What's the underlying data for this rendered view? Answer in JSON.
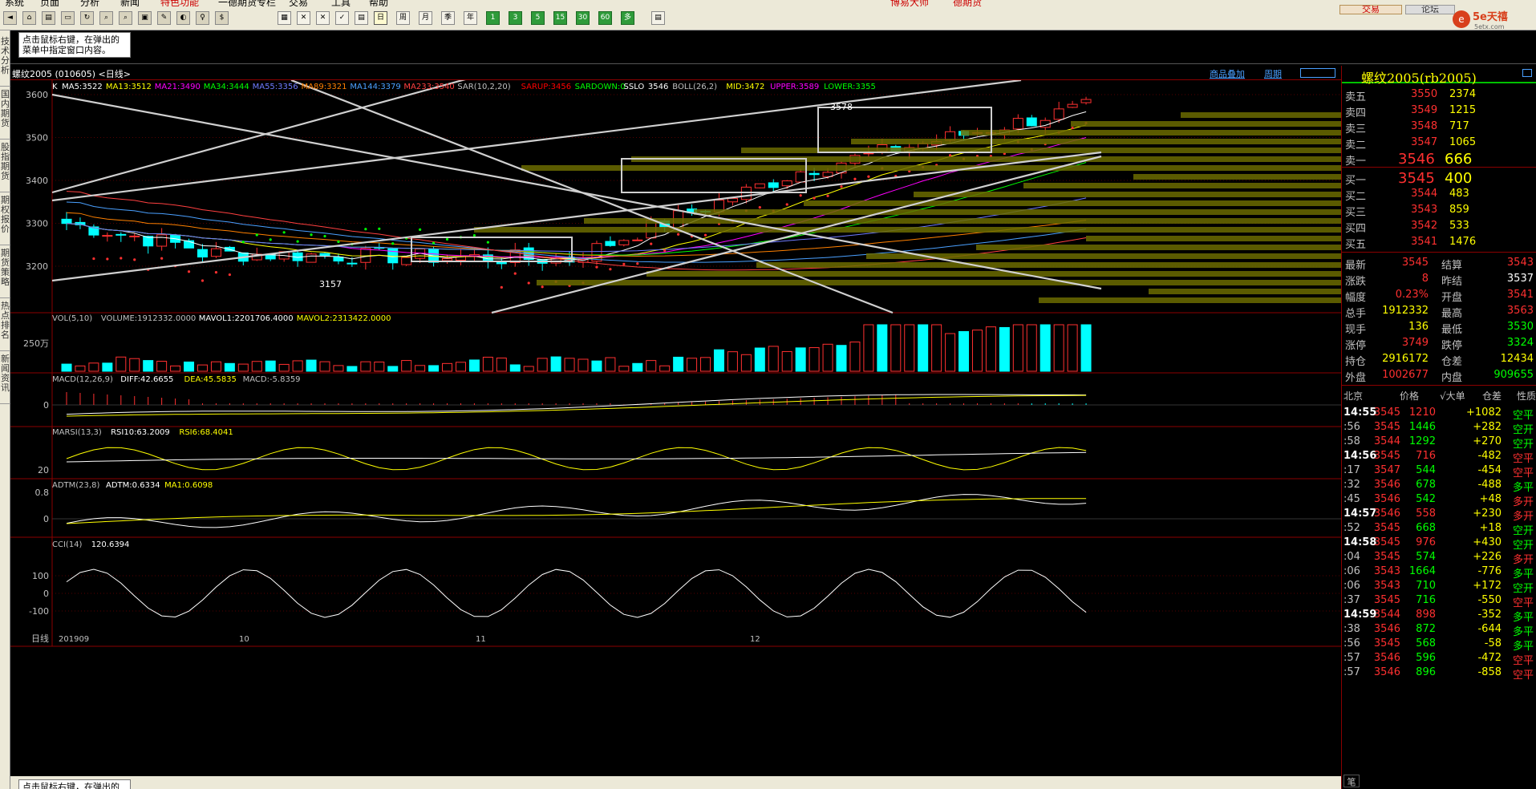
{
  "menu": [
    "系统",
    "页面",
    "分析",
    "新闻",
    "特色功能",
    "一德期货专栏",
    "交易",
    "工具",
    "帮助"
  ],
  "menu_right": [
    "博易大师",
    "德期货"
  ],
  "toolbar": {
    "buttons_a": [
      "◄",
      "⌂",
      "▤",
      "▭",
      "↻",
      "⌕",
      "⌕",
      "▣",
      "✎",
      "◐",
      "♀",
      "$"
    ],
    "periods": [
      "日",
      "周",
      "月",
      "季",
      "年"
    ],
    "minutes": [
      "1",
      "3",
      "5",
      "15",
      "30",
      "60",
      "多"
    ],
    "trade_label": "交易",
    "forum_label": "论坛"
  },
  "logo": {
    "text": "5e天禧",
    "sub": "5etx.com"
  },
  "sidebar_tabs": [
    "技术分析",
    "国内期货",
    "股指期货",
    "期权报价",
    "期货策略",
    "热点排名",
    "新闻资讯"
  ],
  "tip": {
    "text": "点击鼠标右键，在弹出的菜单中指定窗口内容。"
  },
  "tip_bottom": {
    "text": "点击鼠标右键，在弹出的"
  },
  "chart_title": "螺纹2005 (010605) <日线>",
  "chart_links": [
    "商品叠加",
    "周期"
  ],
  "main_indicators": [
    {
      "text": "K",
      "color": "#ffffff"
    },
    {
      "text": "MA5:3522",
      "color": "#ffffff"
    },
    {
      "text": "MA13:3512",
      "color": "#ffff00"
    },
    {
      "text": "MA21:3490",
      "color": "#ff00ff"
    },
    {
      "text": "MA34:3444",
      "color": "#00ff00"
    },
    {
      "text": "MA55:3356",
      "color": "#6f7bff"
    },
    {
      "text": "MA89:3321",
      "color": "#ff8000"
    },
    {
      "text": "MA144:3379",
      "color": "#4aa0ff"
    },
    {
      "text": "MA233:3540",
      "color": "#ff4040"
    },
    {
      "text": "SAR(10,2,20)",
      "color": "#c0c0c0"
    },
    {
      "text": "SARUP:3456",
      "color": "#ff0000"
    },
    {
      "text": "SARDOWN:0",
      "color": "#00ff00"
    },
    {
      "text": "SSLO",
      "color": "#ffffff"
    },
    {
      "text": "3546",
      "color": "#ffffff"
    },
    {
      "text": "BOLL(26,2)",
      "color": "#c0c0c0"
    },
    {
      "text": "MID:3472",
      "color": "#ffff00"
    },
    {
      "text": "UPPER:3589",
      "color": "#ff00ff"
    },
    {
      "text": "LOWER:3355",
      "color": "#00ff00"
    }
  ],
  "price_axis": [
    "3600",
    "3500",
    "3400",
    "3300",
    "3200"
  ],
  "annotations": {
    "high": "3578",
    "low": "3157"
  },
  "vol_indicators": [
    {
      "text": "VOL(5,10)",
      "color": "#c0c0c0"
    },
    {
      "text": "VOLUME:1912332.0000",
      "color": "#c0c0c0"
    },
    {
      "text": "MAVOL1:2201706.4000",
      "color": "#ffffff"
    },
    {
      "text": "MAVOL2:2313422.0000",
      "color": "#ffff00"
    }
  ],
  "vol_axis": "250万",
  "macd_indicators": [
    {
      "text": "MACD(12,26,9)",
      "color": "#c0c0c0"
    },
    {
      "text": "DIFF:42.6655",
      "color": "#ffffff"
    },
    {
      "text": "DEA:45.5835",
      "color": "#ffff00"
    },
    {
      "text": "MACD:-5.8359",
      "color": "#c0c0c0"
    }
  ],
  "macd_axis": "0",
  "marsi_indicators": [
    {
      "text": "MARSI(13,3)",
      "color": "#c0c0c0"
    },
    {
      "text": "RSI10:63.2009",
      "color": "#ffffff"
    },
    {
      "text": "RSI6:68.4041",
      "color": "#ffff00"
    }
  ],
  "marsi_axis": "20",
  "adtm_indicators": [
    {
      "text": "ADTM(23,8)",
      "color": "#c0c0c0"
    },
    {
      "text": "ADTM:0.6334",
      "color": "#ffffff"
    },
    {
      "text": "MA1:0.6098",
      "color": "#ffff00"
    }
  ],
  "adtm_axis": [
    "0.8",
    "0"
  ],
  "cci_indicators": [
    {
      "text": "CCI(14)",
      "color": "#c0c0c0"
    },
    {
      "text": "120.6394",
      "color": "#ffffff"
    }
  ],
  "cci_axis": [
    "100",
    "0",
    "-100"
  ],
  "date_axis": {
    "label": "日线",
    "ticks": [
      "201909",
      "10",
      "11",
      "12"
    ]
  },
  "quote": {
    "title": "螺纹2005(rb2005)",
    "asks": [
      {
        "label": "卖五",
        "price": "3550",
        "vol": "2374"
      },
      {
        "label": "卖四",
        "price": "3549",
        "vol": "1215"
      },
      {
        "label": "卖三",
        "price": "3548",
        "vol": "717"
      },
      {
        "label": "卖二",
        "price": "3547",
        "vol": "1065"
      },
      {
        "label": "卖一",
        "price": "3546",
        "vol": "666"
      }
    ],
    "bids": [
      {
        "label": "买一",
        "price": "3545",
        "vol": "400"
      },
      {
        "label": "买二",
        "price": "3544",
        "vol": "483"
      },
      {
        "label": "买三",
        "price": "3543",
        "vol": "859"
      },
      {
        "label": "买四",
        "price": "3542",
        "vol": "533"
      },
      {
        "label": "买五",
        "price": "3541",
        "vol": "1476"
      }
    ],
    "stats": [
      {
        "l1": "最新",
        "v1": "3545",
        "c1": "#ff3030",
        "l2": "结算",
        "v2": "3543",
        "c2": "#ff3030"
      },
      {
        "l1": "涨跌",
        "v1": "8",
        "c1": "#ff3030",
        "l2": "昨结",
        "v2": "3537",
        "c2": "#ffffff"
      },
      {
        "l1": "幅度",
        "v1": "0.23%",
        "c1": "#ff3030",
        "l2": "开盘",
        "v2": "3541",
        "c2": "#ff3030"
      },
      {
        "l1": "总手",
        "v1": "1912332",
        "c1": "#ffff00",
        "l2": "最高",
        "v2": "3563",
        "c2": "#ff3030"
      },
      {
        "l1": "现手",
        "v1": "136",
        "c1": "#ffff00",
        "l2": "最低",
        "v2": "3530",
        "c2": "#00ff00"
      },
      {
        "l1": "涨停",
        "v1": "3749",
        "c1": "#ff3030",
        "l2": "跌停",
        "v2": "3324",
        "c2": "#00ff00"
      },
      {
        "l1": "持仓",
        "v1": "2916172",
        "c1": "#ffff00",
        "l2": "仓差",
        "v2": "12434",
        "c2": "#ffff00"
      },
      {
        "l1": "外盘",
        "v1": "1002677",
        "c1": "#ff3030",
        "l2": "内盘",
        "v2": "909655",
        "c2": "#00ff00"
      }
    ],
    "trade_header": [
      "北京",
      "价格",
      "√大单",
      "仓差",
      "性质"
    ],
    "trades": [
      {
        "t": "14:55",
        "p": "3545",
        "v": "1210",
        "d": "+1082",
        "n": "空平",
        "main": true,
        "pc": "#ff3030",
        "dc": "#ffff00",
        "nc": "#00ff00"
      },
      {
        "t": ":56",
        "p": "3545",
        "v": "1446",
        "d": "+282",
        "n": "空开",
        "main": false,
        "pc": "#ff3030",
        "dc": "#ffff00",
        "nc": "#00ff00"
      },
      {
        "t": ":58",
        "p": "3544",
        "v": "1292",
        "d": "+270",
        "n": "空开",
        "main": false,
        "pc": "#ff3030",
        "dc": "#ffff00",
        "nc": "#00ff00"
      },
      {
        "t": "14:56",
        "p": "3545",
        "v": "716",
        "d": "-482",
        "n": "空平",
        "main": true,
        "pc": "#ff3030",
        "dc": "#ffff00",
        "nc": "#ff3030"
      },
      {
        "t": ":17",
        "p": "3547",
        "v": "544",
        "d": "-454",
        "n": "空平",
        "main": false,
        "pc": "#ff3030",
        "dc": "#ffff00",
        "nc": "#ff3030"
      },
      {
        "t": ":32",
        "p": "3546",
        "v": "678",
        "d": "-488",
        "n": "多平",
        "main": false,
        "pc": "#ff3030",
        "dc": "#ffff00",
        "nc": "#00ff00"
      },
      {
        "t": ":45",
        "p": "3546",
        "v": "542",
        "d": "+48",
        "n": "多开",
        "main": false,
        "pc": "#ff3030",
        "dc": "#ffff00",
        "nc": "#ff3030"
      },
      {
        "t": "14:57",
        "p": "3546",
        "v": "558",
        "d": "+230",
        "n": "多开",
        "main": true,
        "pc": "#ff3030",
        "dc": "#ffff00",
        "nc": "#ff3030"
      },
      {
        "t": ":52",
        "p": "3545",
        "v": "668",
        "d": "+18",
        "n": "空开",
        "main": false,
        "pc": "#ff3030",
        "dc": "#ffff00",
        "nc": "#00ff00"
      },
      {
        "t": "14:58",
        "p": "3545",
        "v": "976",
        "d": "+430",
        "n": "空开",
        "main": true,
        "pc": "#ff3030",
        "dc": "#ffff00",
        "nc": "#00ff00"
      },
      {
        "t": ":04",
        "p": "3545",
        "v": "574",
        "d": "+226",
        "n": "多开",
        "main": false,
        "pc": "#ff3030",
        "dc": "#ffff00",
        "nc": "#ff3030"
      },
      {
        "t": ":06",
        "p": "3543",
        "v": "1664",
        "d": "-776",
        "n": "多平",
        "main": false,
        "pc": "#ff3030",
        "dc": "#ffff00",
        "nc": "#00ff00"
      },
      {
        "t": ":06",
        "p": "3543",
        "v": "710",
        "d": "+172",
        "n": "空开",
        "main": false,
        "pc": "#ff3030",
        "dc": "#ffff00",
        "nc": "#00ff00"
      },
      {
        "t": ":37",
        "p": "3545",
        "v": "716",
        "d": "-550",
        "n": "空平",
        "main": false,
        "pc": "#ff3030",
        "dc": "#ffff00",
        "nc": "#ff3030"
      },
      {
        "t": "14:59",
        "p": "3544",
        "v": "898",
        "d": "-352",
        "n": "多平",
        "main": true,
        "pc": "#ff3030",
        "dc": "#ffff00",
        "nc": "#00ff00"
      },
      {
        "t": ":38",
        "p": "3546",
        "v": "872",
        "d": "-644",
        "n": "多平",
        "main": false,
        "pc": "#ff3030",
        "dc": "#ffff00",
        "nc": "#00ff00"
      },
      {
        "t": ":56",
        "p": "3545",
        "v": "568",
        "d": "-58",
        "n": "多平",
        "main": false,
        "pc": "#ff3030",
        "dc": "#ffff00",
        "nc": "#00ff00"
      },
      {
        "t": ":57",
        "p": "3546",
        "v": "596",
        "d": "-472",
        "n": "空平",
        "main": false,
        "pc": "#ff3030",
        "dc": "#ffff00",
        "nc": "#ff3030"
      },
      {
        "t": ":57",
        "p": "3546",
        "v": "896",
        "d": "-858",
        "n": "空平",
        "main": false,
        "pc": "#ff3030",
        "dc": "#ffff00",
        "nc": "#ff3030"
      }
    ],
    "footer_tab": "笔"
  }
}
